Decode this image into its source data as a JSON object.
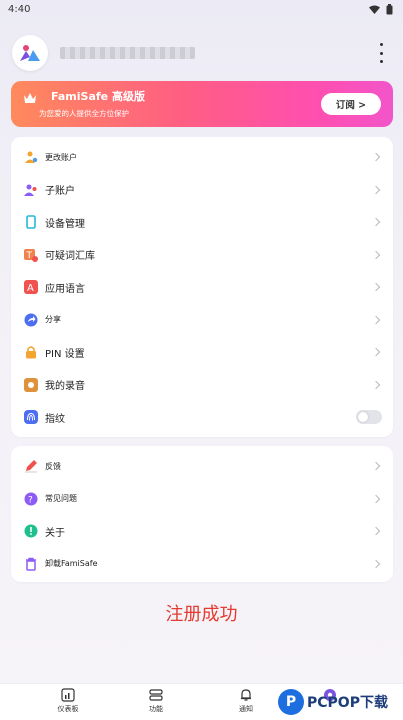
{
  "status_bar": {
    "time": "4:40"
  },
  "banner": {
    "title": "FamiSafe 高级版",
    "subtitle": "为您爱的人提供全方位保护",
    "subscribe_label": "订阅 >"
  },
  "menu_main": [
    {
      "label": "更改账户",
      "icon": "account-switch-icon",
      "color": "#f2a531",
      "small": true
    },
    {
      "label": "子账户",
      "icon": "child-account-icon",
      "color": "#8b5cf6"
    },
    {
      "label": "设备管理",
      "icon": "device-icon",
      "color": "#22b8d8"
    },
    {
      "label": "可疑词汇库",
      "icon": "suspicious-words-icon",
      "color": "#f2824b"
    },
    {
      "label": "应用语言",
      "icon": "language-icon",
      "color": "#f0524f"
    },
    {
      "label": "分享",
      "icon": "share-icon",
      "color": "#4d6ef0",
      "small": true
    },
    {
      "label": "PIN 设置",
      "icon": "lock-icon",
      "color": "#f2a531"
    },
    {
      "label": "我的录音",
      "icon": "recording-icon",
      "color": "#e0913c"
    },
    {
      "label": "指纹",
      "icon": "fingerprint-icon",
      "color": "#4d6ef0",
      "toggle": true,
      "enabled": false
    }
  ],
  "menu_support": [
    {
      "label": "反馈",
      "icon": "feedback-icon",
      "color": "#f0524f",
      "small": true
    },
    {
      "label": "常见问题",
      "icon": "faq-icon",
      "color": "#8b5cf6",
      "small": true
    },
    {
      "label": "关于",
      "icon": "info-icon",
      "color": "#1fbf8f"
    },
    {
      "label": "卸载FamiSafe",
      "icon": "uninstall-icon",
      "color": "#8b5cf6",
      "small": true
    }
  ],
  "success_message": "注册成功",
  "tabs": [
    {
      "label": "仪表板",
      "icon": "dashboard-icon"
    },
    {
      "label": "功能",
      "icon": "features-icon"
    },
    {
      "label": "通知",
      "icon": "bell-icon"
    },
    {
      "label": "",
      "icon": "settings-icon",
      "active": true
    }
  ],
  "watermark": {
    "p": "P",
    "text": "PCPOP下载"
  },
  "colors": {
    "accent": "#6a4bd8",
    "success_text": "#e43a2f"
  }
}
